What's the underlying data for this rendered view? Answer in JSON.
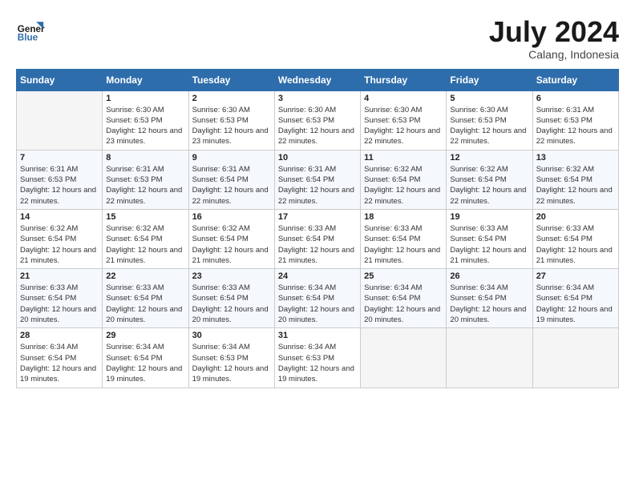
{
  "header": {
    "logo_line1": "General",
    "logo_line2": "Blue",
    "month_title": "July 2024",
    "location": "Calang, Indonesia"
  },
  "weekdays": [
    "Sunday",
    "Monday",
    "Tuesday",
    "Wednesday",
    "Thursday",
    "Friday",
    "Saturday"
  ],
  "weeks": [
    [
      {
        "day": "",
        "sunrise": "",
        "sunset": "",
        "daylight": ""
      },
      {
        "day": "1",
        "sunrise": "6:30 AM",
        "sunset": "6:53 PM",
        "daylight": "12 hours and 23 minutes."
      },
      {
        "day": "2",
        "sunrise": "6:30 AM",
        "sunset": "6:53 PM",
        "daylight": "12 hours and 23 minutes."
      },
      {
        "day": "3",
        "sunrise": "6:30 AM",
        "sunset": "6:53 PM",
        "daylight": "12 hours and 22 minutes."
      },
      {
        "day": "4",
        "sunrise": "6:30 AM",
        "sunset": "6:53 PM",
        "daylight": "12 hours and 22 minutes."
      },
      {
        "day": "5",
        "sunrise": "6:30 AM",
        "sunset": "6:53 PM",
        "daylight": "12 hours and 22 minutes."
      },
      {
        "day": "6",
        "sunrise": "6:31 AM",
        "sunset": "6:53 PM",
        "daylight": "12 hours and 22 minutes."
      }
    ],
    [
      {
        "day": "7",
        "sunrise": "6:31 AM",
        "sunset": "6:53 PM",
        "daylight": "12 hours and 22 minutes."
      },
      {
        "day": "8",
        "sunrise": "6:31 AM",
        "sunset": "6:53 PM",
        "daylight": "12 hours and 22 minutes."
      },
      {
        "day": "9",
        "sunrise": "6:31 AM",
        "sunset": "6:54 PM",
        "daylight": "12 hours and 22 minutes."
      },
      {
        "day": "10",
        "sunrise": "6:31 AM",
        "sunset": "6:54 PM",
        "daylight": "12 hours and 22 minutes."
      },
      {
        "day": "11",
        "sunrise": "6:32 AM",
        "sunset": "6:54 PM",
        "daylight": "12 hours and 22 minutes."
      },
      {
        "day": "12",
        "sunrise": "6:32 AM",
        "sunset": "6:54 PM",
        "daylight": "12 hours and 22 minutes."
      },
      {
        "day": "13",
        "sunrise": "6:32 AM",
        "sunset": "6:54 PM",
        "daylight": "12 hours and 22 minutes."
      }
    ],
    [
      {
        "day": "14",
        "sunrise": "6:32 AM",
        "sunset": "6:54 PM",
        "daylight": "12 hours and 21 minutes."
      },
      {
        "day": "15",
        "sunrise": "6:32 AM",
        "sunset": "6:54 PM",
        "daylight": "12 hours and 21 minutes."
      },
      {
        "day": "16",
        "sunrise": "6:32 AM",
        "sunset": "6:54 PM",
        "daylight": "12 hours and 21 minutes."
      },
      {
        "day": "17",
        "sunrise": "6:33 AM",
        "sunset": "6:54 PM",
        "daylight": "12 hours and 21 minutes."
      },
      {
        "day": "18",
        "sunrise": "6:33 AM",
        "sunset": "6:54 PM",
        "daylight": "12 hours and 21 minutes."
      },
      {
        "day": "19",
        "sunrise": "6:33 AM",
        "sunset": "6:54 PM",
        "daylight": "12 hours and 21 minutes."
      },
      {
        "day": "20",
        "sunrise": "6:33 AM",
        "sunset": "6:54 PM",
        "daylight": "12 hours and 21 minutes."
      }
    ],
    [
      {
        "day": "21",
        "sunrise": "6:33 AM",
        "sunset": "6:54 PM",
        "daylight": "12 hours and 20 minutes."
      },
      {
        "day": "22",
        "sunrise": "6:33 AM",
        "sunset": "6:54 PM",
        "daylight": "12 hours and 20 minutes."
      },
      {
        "day": "23",
        "sunrise": "6:33 AM",
        "sunset": "6:54 PM",
        "daylight": "12 hours and 20 minutes."
      },
      {
        "day": "24",
        "sunrise": "6:34 AM",
        "sunset": "6:54 PM",
        "daylight": "12 hours and 20 minutes."
      },
      {
        "day": "25",
        "sunrise": "6:34 AM",
        "sunset": "6:54 PM",
        "daylight": "12 hours and 20 minutes."
      },
      {
        "day": "26",
        "sunrise": "6:34 AM",
        "sunset": "6:54 PM",
        "daylight": "12 hours and 20 minutes."
      },
      {
        "day": "27",
        "sunrise": "6:34 AM",
        "sunset": "6:54 PM",
        "daylight": "12 hours and 19 minutes."
      }
    ],
    [
      {
        "day": "28",
        "sunrise": "6:34 AM",
        "sunset": "6:54 PM",
        "daylight": "12 hours and 19 minutes."
      },
      {
        "day": "29",
        "sunrise": "6:34 AM",
        "sunset": "6:54 PM",
        "daylight": "12 hours and 19 minutes."
      },
      {
        "day": "30",
        "sunrise": "6:34 AM",
        "sunset": "6:53 PM",
        "daylight": "12 hours and 19 minutes."
      },
      {
        "day": "31",
        "sunrise": "6:34 AM",
        "sunset": "6:53 PM",
        "daylight": "12 hours and 19 minutes."
      },
      {
        "day": "",
        "sunrise": "",
        "sunset": "",
        "daylight": ""
      },
      {
        "day": "",
        "sunrise": "",
        "sunset": "",
        "daylight": ""
      },
      {
        "day": "",
        "sunrise": "",
        "sunset": "",
        "daylight": ""
      }
    ]
  ],
  "labels": {
    "sunrise_prefix": "Sunrise: ",
    "sunset_prefix": "Sunset: ",
    "daylight_prefix": "Daylight: "
  }
}
